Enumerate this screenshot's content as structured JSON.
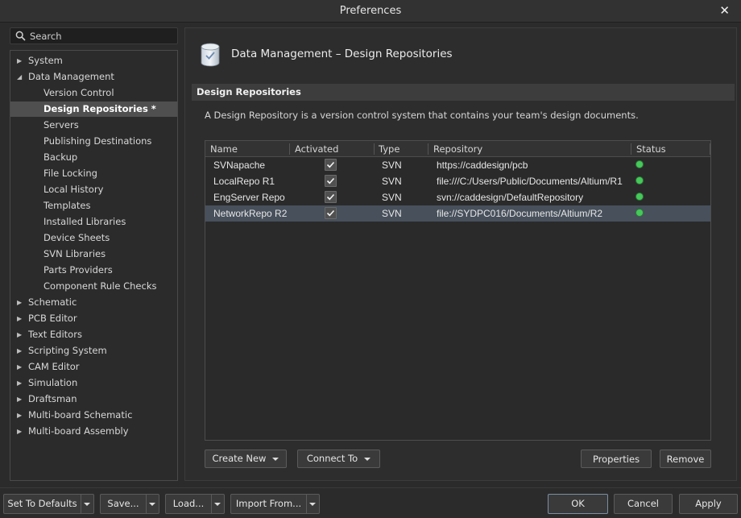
{
  "window": {
    "title": "Preferences",
    "close_glyph": "✕"
  },
  "search": {
    "placeholder": "Search"
  },
  "tree": {
    "items": [
      {
        "label": "System",
        "kind": "top",
        "expanded": false
      },
      {
        "label": "Data Management",
        "kind": "top",
        "expanded": true
      },
      {
        "label": "Version Control",
        "kind": "child"
      },
      {
        "label": "Design Repositories *",
        "kind": "child",
        "selected": true
      },
      {
        "label": "Servers",
        "kind": "child"
      },
      {
        "label": "Publishing Destinations",
        "kind": "child"
      },
      {
        "label": "Backup",
        "kind": "child"
      },
      {
        "label": "File Locking",
        "kind": "child"
      },
      {
        "label": "Local History",
        "kind": "child"
      },
      {
        "label": "Templates",
        "kind": "child"
      },
      {
        "label": "Installed Libraries",
        "kind": "child"
      },
      {
        "label": "Device Sheets",
        "kind": "child"
      },
      {
        "label": "SVN Libraries",
        "kind": "child"
      },
      {
        "label": "Parts Providers",
        "kind": "child"
      },
      {
        "label": "Component Rule Checks",
        "kind": "child"
      },
      {
        "label": "Schematic",
        "kind": "top",
        "expanded": false
      },
      {
        "label": "PCB Editor",
        "kind": "top",
        "expanded": false
      },
      {
        "label": "Text Editors",
        "kind": "top",
        "expanded": false
      },
      {
        "label": "Scripting System",
        "kind": "top",
        "expanded": false
      },
      {
        "label": "CAM Editor",
        "kind": "top",
        "expanded": false
      },
      {
        "label": "Simulation",
        "kind": "top",
        "expanded": false
      },
      {
        "label": "Draftsman",
        "kind": "top",
        "expanded": false
      },
      {
        "label": "Multi-board Schematic",
        "kind": "top",
        "expanded": false
      },
      {
        "label": "Multi-board Assembly",
        "kind": "top",
        "expanded": false
      }
    ]
  },
  "page": {
    "header_title": "Data Management – Design Repositories",
    "header_icon": "database-icon",
    "section_title": "Design Repositories",
    "description": "A Design Repository is a version control system that contains your team's design documents."
  },
  "grid": {
    "columns": [
      "Name",
      "Activated",
      "Type",
      "Repository",
      "Status"
    ],
    "rows": [
      {
        "name": "SVNapache",
        "activated": true,
        "type": "SVN",
        "repository": "https://caddesign/pcb",
        "status": "ok"
      },
      {
        "name": "LocalRepo R1",
        "activated": true,
        "type": "SVN",
        "repository": "file:///C:/Users/Public/Documents/Altium/R1",
        "status": "ok"
      },
      {
        "name": "EngServer Repo",
        "activated": true,
        "type": "SVN",
        "repository": "svn://caddesign/DefaultRepository",
        "status": "ok"
      },
      {
        "name": "NetworkRepo R2",
        "activated": true,
        "type": "SVN",
        "repository": "file://SYDPC016/Documents/Altium/R2",
        "status": "ok",
        "selected": true
      }
    ],
    "status_color": "#46c85a"
  },
  "actions": {
    "create_new": "Create New",
    "connect_to": "Connect To",
    "properties": "Properties",
    "remove": "Remove"
  },
  "footer": {
    "set_to_defaults": "Set To Defaults",
    "save": "Save...",
    "load": "Load...",
    "import_from": "Import From...",
    "ok": "OK",
    "cancel": "Cancel",
    "apply": "Apply"
  },
  "colors": {
    "selection": "#47505b",
    "tree_selection": "#4f4f4f"
  }
}
